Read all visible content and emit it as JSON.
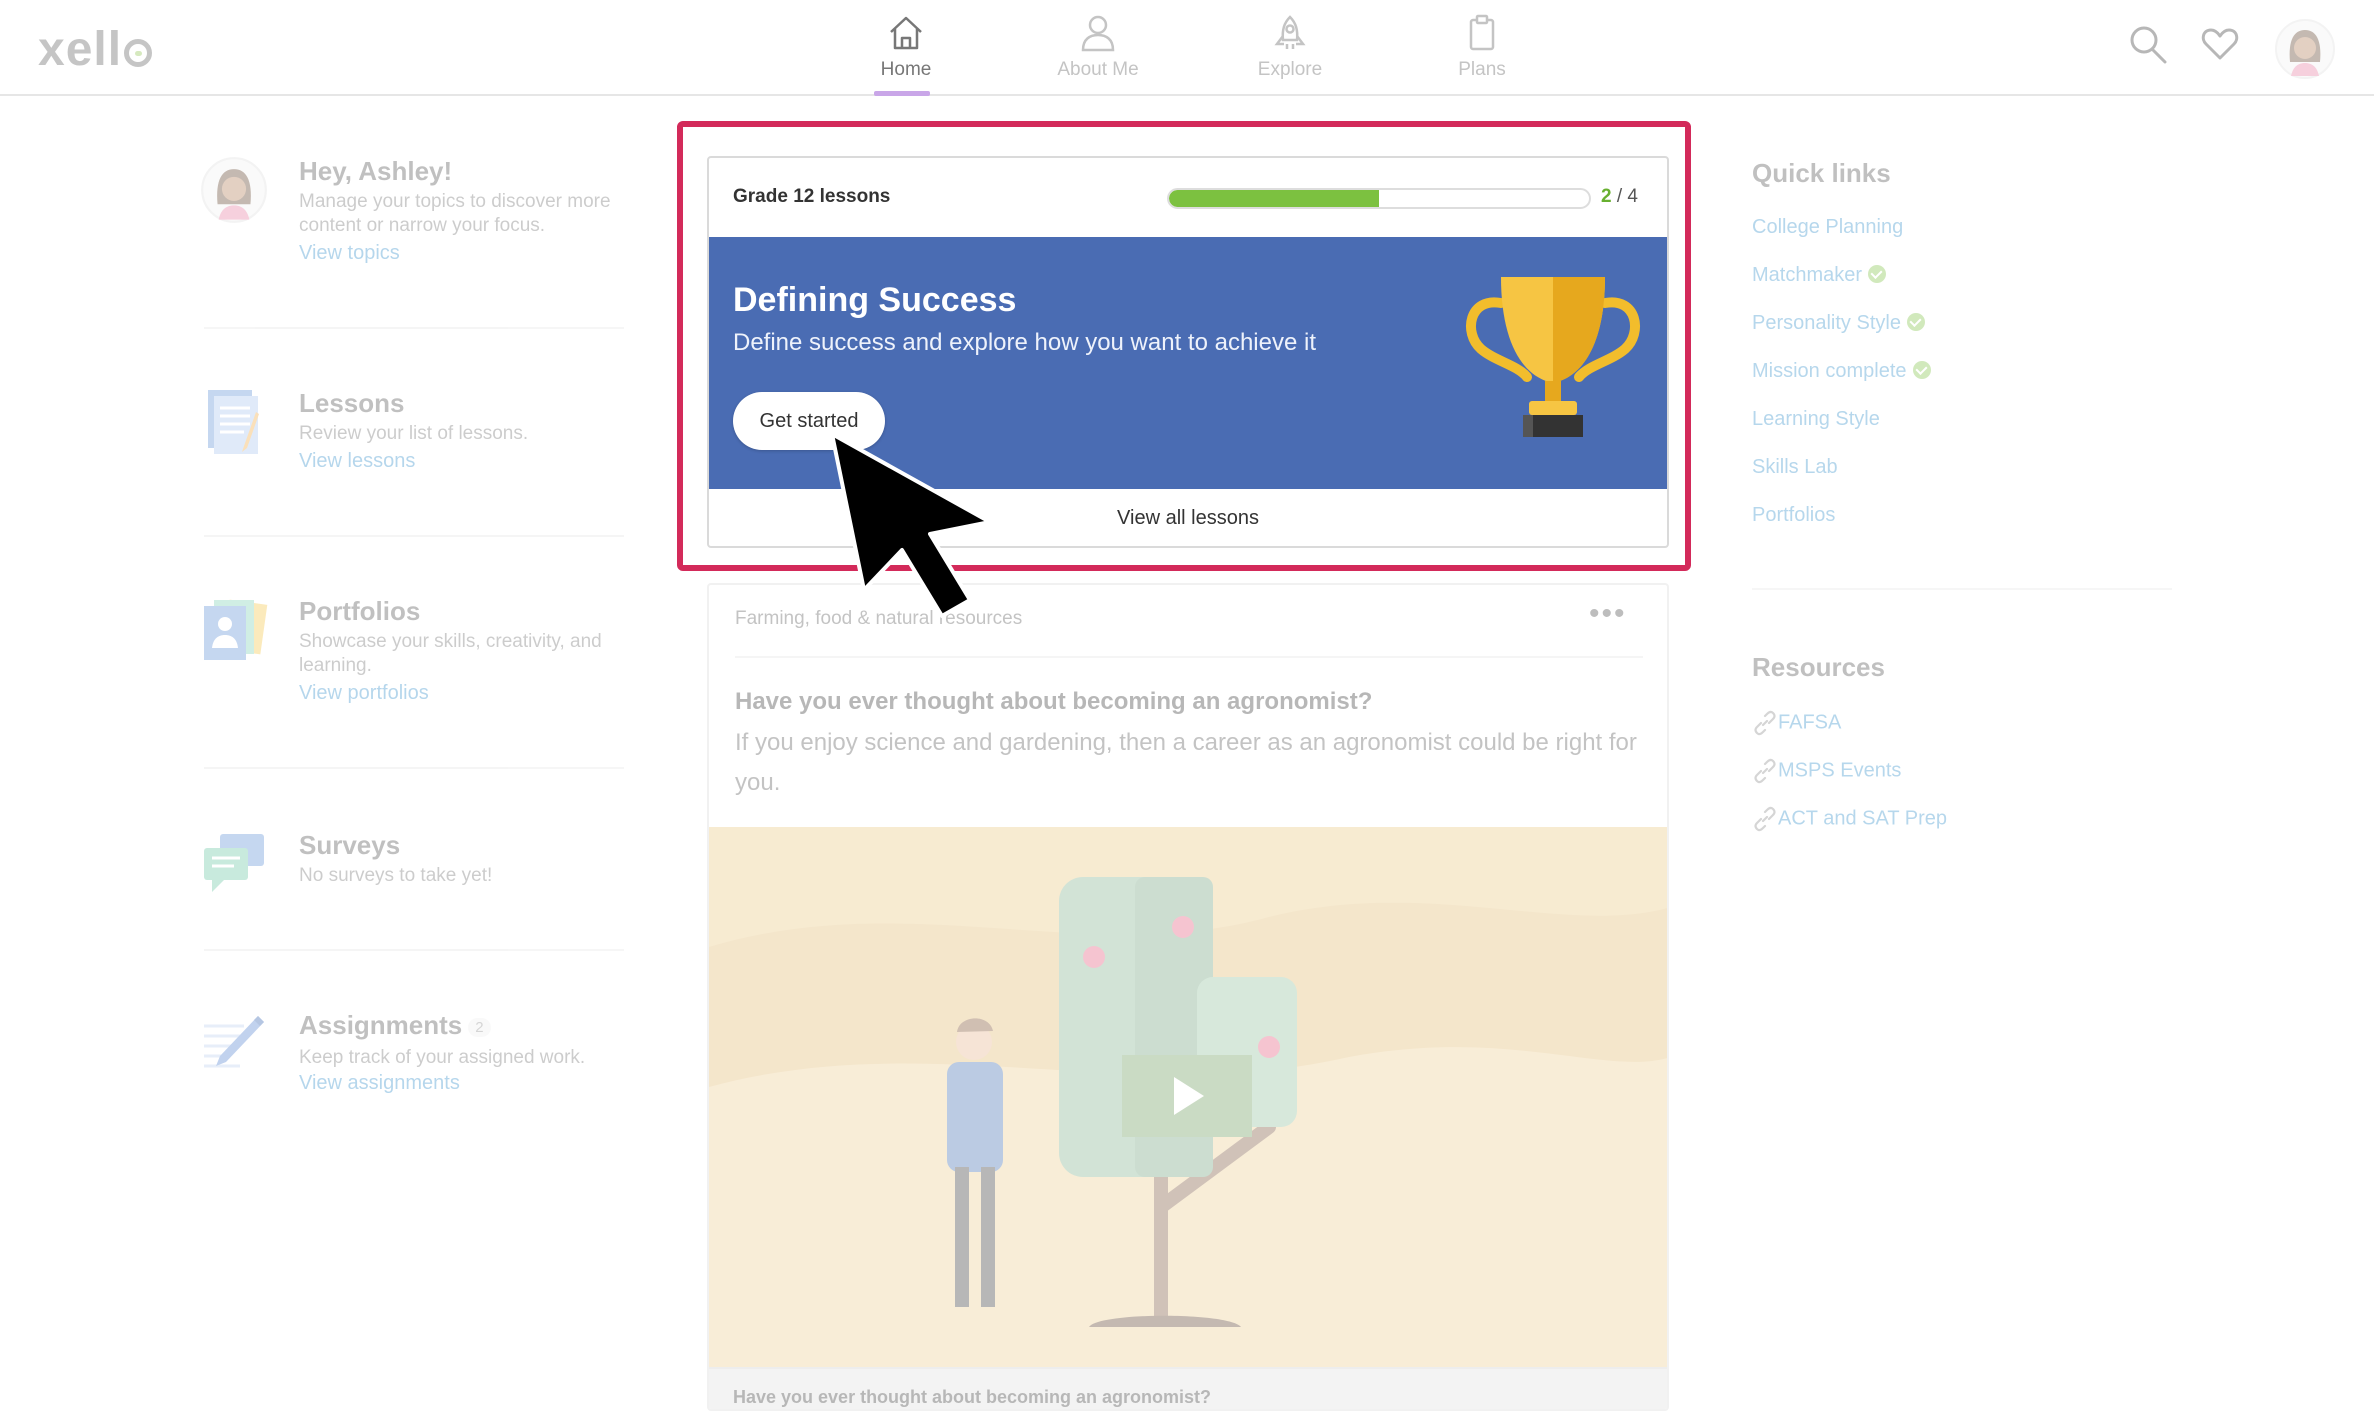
{
  "header": {
    "logo": "xello",
    "nav": [
      {
        "label": "Home",
        "active": true
      },
      {
        "label": "About Me",
        "active": false
      },
      {
        "label": "Explore",
        "active": false
      },
      {
        "label": "Plans",
        "active": false
      }
    ]
  },
  "left": {
    "greeting": {
      "title": "Hey, Ashley!",
      "desc": "Manage your topics to discover more content or narrow your focus.",
      "link": "View topics"
    },
    "lessons": {
      "title": "Lessons",
      "desc": "Review your list of lessons.",
      "link": "View lessons"
    },
    "portfolios": {
      "title": "Portfolios",
      "desc": "Showcase your skills, creativity, and learning.",
      "link": "View portfolios"
    },
    "surveys": {
      "title": "Surveys",
      "desc": "No surveys to take yet!"
    },
    "assignments": {
      "title": "Assignments",
      "count": "2",
      "desc": "Keep track of your assigned work.",
      "link": "View assignments"
    }
  },
  "lesson_card": {
    "title": "Grade 12 lessons",
    "progress_done": "2",
    "progress_sep": " / ",
    "progress_total": "4",
    "progress_fraction": 0.5,
    "banner_title": "Defining Success",
    "banner_subtitle": "Define success and explore how you want to achieve it",
    "cta": "Get started",
    "view_all": "View all lessons",
    "banner_color": "#4a6cb3",
    "progress_color": "#7cc140"
  },
  "career_card": {
    "category": "Farming, food & natural resources",
    "more": "•••",
    "question": "Have you ever thought about becoming an agronomist?",
    "answer": "If you enjoy science and gardening, then a career as an agronomist could be right for you.",
    "footer": "Have you ever thought about becoming an agronomist?"
  },
  "quick_links": {
    "title": "Quick links",
    "items": [
      {
        "label": "College Planning",
        "done": false
      },
      {
        "label": "Matchmaker",
        "done": true
      },
      {
        "label": "Personality Style",
        "done": true
      },
      {
        "label": "Mission complete",
        "done": true
      },
      {
        "label": "Learning Style",
        "done": false
      },
      {
        "label": "Skills Lab",
        "done": false
      },
      {
        "label": "Portfolios",
        "done": false
      }
    ]
  },
  "resources": {
    "title": "Resources",
    "items": [
      "FAFSA",
      "MSPS Events",
      "ACT and SAT Prep"
    ]
  },
  "colors": {
    "link": "#2f8cc9",
    "focus_ring": "#d32a5a",
    "active_underline": "#c9a6e8"
  }
}
